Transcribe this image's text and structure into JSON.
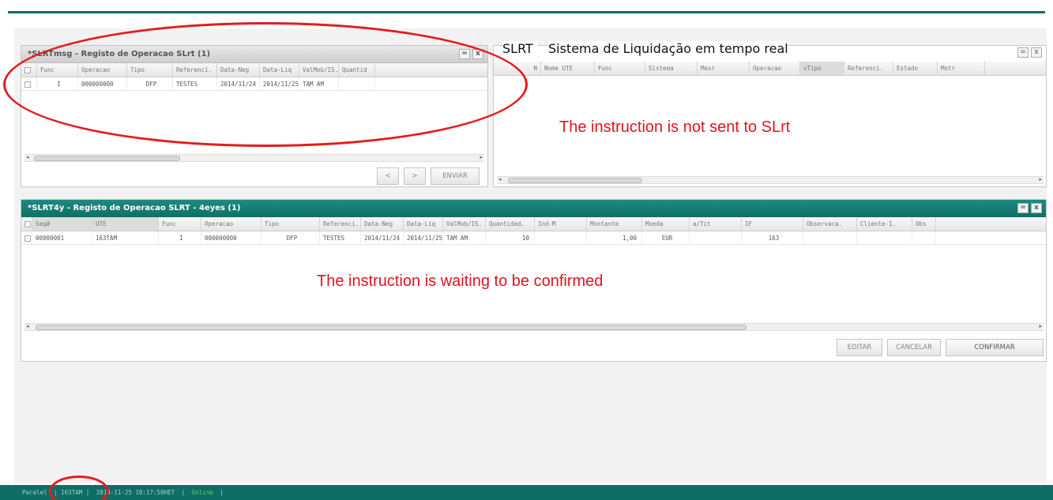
{
  "panel_msg": {
    "title": "*SLRTmsg - Registo de Operacao SLrt (1)",
    "minimize": "=",
    "close": "x",
    "columns": [
      "",
      "Func",
      "Operacao",
      "Tipo",
      "Referenci.",
      "Data-Neg",
      "Data-Liq",
      "ValMob/IS.",
      "Quantid"
    ],
    "rows": [
      [
        "",
        "I",
        "000000000",
        "DFP",
        "TESTES",
        "2014/11/24",
        "2014/11/25",
        "TAM AM",
        ""
      ]
    ],
    "nav_prev": "<",
    "nav_next": ">",
    "send_label": "ENVIAR"
  },
  "panel_slrt": {
    "logo": "SLRT",
    "title": "Sistema de Liquidação em tempo real",
    "minimize": "=",
    "close": "x",
    "columns": [
      "N",
      "Nome UTE",
      "Func",
      "Sistema",
      "Mesr",
      "Operacao",
      "vTipo",
      "Referenci.",
      "Estado",
      "Motr"
    ]
  },
  "panel_4eyes": {
    "title": "*SLRT4y - Registo de Operacao SLRT - 4eyes (1)",
    "minimize": "=",
    "close": "x",
    "columns": [
      "",
      "Seq#",
      "UTE",
      "Func",
      "Operacao",
      "Tipo",
      "Referenci.",
      "Data-Neg",
      "Data-Liq",
      "ValMob/IS.",
      "Quantidad.",
      "Ind-M",
      "Montante",
      "Moeda",
      "a/Tit",
      "IF",
      "Observaca.",
      "Cliente-I.",
      "Obs"
    ],
    "rows": [
      [
        "",
        "00000001",
        "163TAM",
        "I",
        "000000000",
        "DFP",
        "TESTES",
        "2014/11/24",
        "2014/11/25",
        "TAM AM",
        "10",
        "",
        "1,00",
        "EUR",
        "",
        "163",
        "",
        "",
        ""
      ]
    ],
    "buttons": {
      "edit": "EDITAR",
      "cancel": "CANCELAR",
      "confirm": "CONFIRMAR"
    }
  },
  "annotations": {
    "not_sent": "The instruction is not sent to SLrt",
    "waiting": "The instruction is waiting to be confirmed"
  },
  "status_bar": {
    "items": [
      "Paralel",
      "| 163TAM |",
      "2014-11-25 10:17:50HET",
      "|",
      "Online",
      "|"
    ]
  },
  "colors": {
    "teal": "#0e6e66",
    "annotation_red": "#e0141e"
  }
}
